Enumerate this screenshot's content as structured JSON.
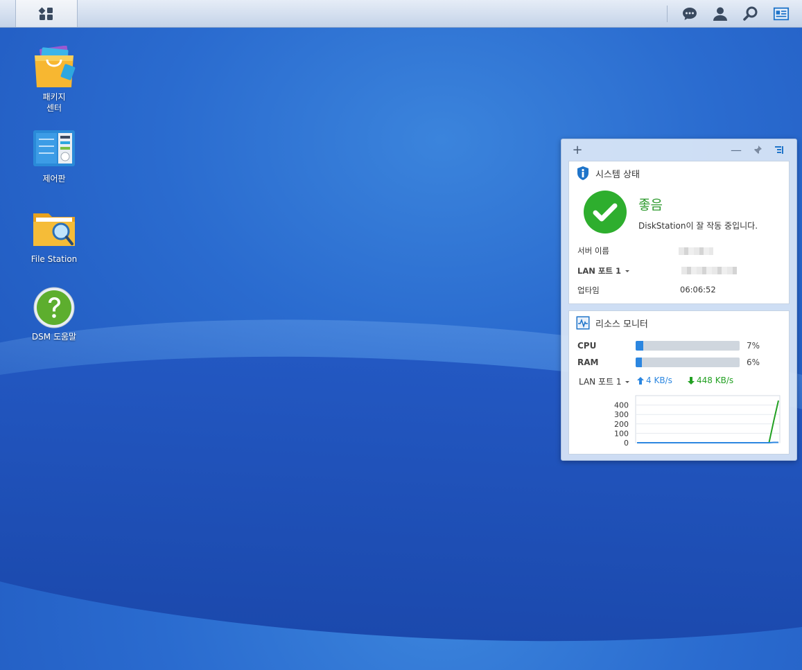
{
  "desktop": {
    "icons": [
      {
        "label_line1": "패키지",
        "label_line2": "센터",
        "icon": "package-center-icon"
      },
      {
        "label_line1": "제어판",
        "icon": "control-panel-icon"
      },
      {
        "label_line1": "File Station",
        "icon": "file-station-icon"
      },
      {
        "label_line1": "DSM 도움말",
        "icon": "dsm-help-icon"
      }
    ]
  },
  "taskbar": {
    "icons": [
      "main-menu-icon",
      "notification-icon",
      "user-icon",
      "search-icon",
      "widgets-icon"
    ]
  },
  "widgets": {
    "toolbar": {
      "add": "+",
      "minimize": "—"
    },
    "system_health": {
      "title": "시스템 상태",
      "status": "좋음",
      "message": "DiskStation이 잘 작동 중입니다.",
      "rows": [
        {
          "label": "서버 이름",
          "value": ""
        },
        {
          "label": "LAN 포트 1",
          "value": ""
        },
        {
          "label": "업타임",
          "value": "06:06:52"
        }
      ]
    },
    "resource_monitor": {
      "title": "리소스 모니터",
      "cpu_label": "CPU",
      "cpu_percent": 7,
      "cpu_text": "7%",
      "ram_label": "RAM",
      "ram_percent": 6,
      "ram_text": "6%",
      "lan_label": "LAN 포트 1",
      "upload": "4 KB/s",
      "download": "448 KB/s",
      "colors": {
        "upload": "#2b86e0",
        "download": "#22a022"
      }
    }
  },
  "chart_data": {
    "type": "line",
    "ylim": [
      0,
      500
    ],
    "yticks": [
      "400",
      "300",
      "200",
      "100",
      "0"
    ],
    "series": [
      {
        "values": [
          0,
          0,
          0,
          0,
          0,
          0,
          0,
          0,
          0,
          0,
          0,
          0,
          0,
          0,
          0,
          0,
          0,
          0,
          0,
          0,
          0,
          0,
          0,
          0,
          0,
          0,
          0,
          0,
          0,
          230,
          448
        ],
        "color": "#22a022"
      },
      {
        "values": [
          0,
          0,
          0,
          0,
          0,
          0,
          0,
          0,
          0,
          0,
          0,
          0,
          0,
          0,
          0,
          0,
          0,
          0,
          0,
          0,
          0,
          0,
          0,
          0,
          0,
          0,
          0,
          0,
          0,
          4,
          4
        ],
        "color": "#2b86e0"
      }
    ]
  }
}
